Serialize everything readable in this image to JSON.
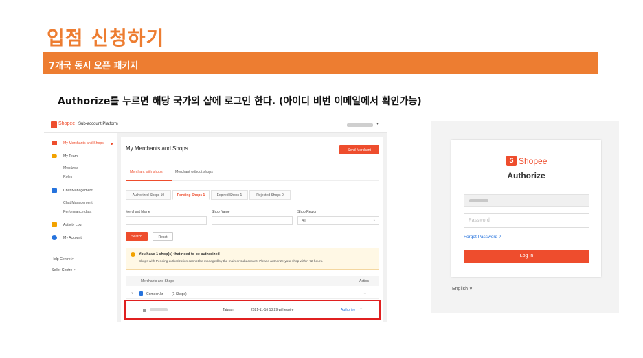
{
  "slide": {
    "title": "입점 신청하기",
    "banner": "7개국 동시 오픈 패키지",
    "instruction": "Authorize를 누르면 해당 국가의 샵에 로그인 한다. (아이디 비번 이메일에서 확인가능)"
  },
  "platform": {
    "logo_text": "Shopee",
    "title": "Sub-account Platform",
    "user_menu_caret": "▾",
    "sidebar": {
      "main_items": [
        {
          "label": "My Merchants and Shops",
          "icon": "store-icon",
          "active": true
        },
        {
          "label": "My Team",
          "icon": "team-icon"
        },
        {
          "label": "Chat Management",
          "icon": "chat-icon"
        },
        {
          "label": "Activity Log",
          "icon": "log-icon"
        },
        {
          "label": "My Account",
          "icon": "account-icon"
        }
      ],
      "team_sub": [
        "Members",
        "Roles"
      ],
      "chat_sub": [
        "Chat Management",
        "Performance data"
      ],
      "help_centre": "Help Centre  >",
      "seller_centre": "Seller Centre  >"
    },
    "content": {
      "title": "My Merchants and Shops",
      "send_button": "Send Merchant",
      "main_tabs": [
        "Merchant with shops",
        "Merchant without shops"
      ],
      "status_tabs": [
        "Authorized Shops 10",
        "Pending Shops 1",
        "Expired Shops 1",
        "Rejected Shops 0"
      ],
      "filters": {
        "merchant_name_label": "Merchant Name",
        "shop_name_label": "Shop Name",
        "shop_region_label": "Shop Region",
        "shop_region_value": "All"
      },
      "search_button": "Search",
      "reset_button": "Reset",
      "notice_icon": "!",
      "notice_title": "You have 1 shop(s) that need to be authorized",
      "notice_desc": "Shops with Pending authorization cannot be managed by the main or subaccount. Please authorize your shop within 72 hours.",
      "table": {
        "col_shops": "Merchants and Shops",
        "col_action": "Action",
        "group_chevron": "∨",
        "group_name": "Comeon.kr",
        "group_count": "(1 Shops)",
        "dots": "···",
        "row": {
          "region": "Taiwan",
          "expire": "2021-11-16 13:29 will expire",
          "action": "Authorize"
        }
      }
    }
  },
  "login": {
    "bag_letter": "S",
    "brand": "Shopee",
    "title": "Authorize",
    "password_placeholder": "Password",
    "forgot": "Forgot Password ?",
    "login_button": "Log In",
    "language": "English ∨"
  }
}
